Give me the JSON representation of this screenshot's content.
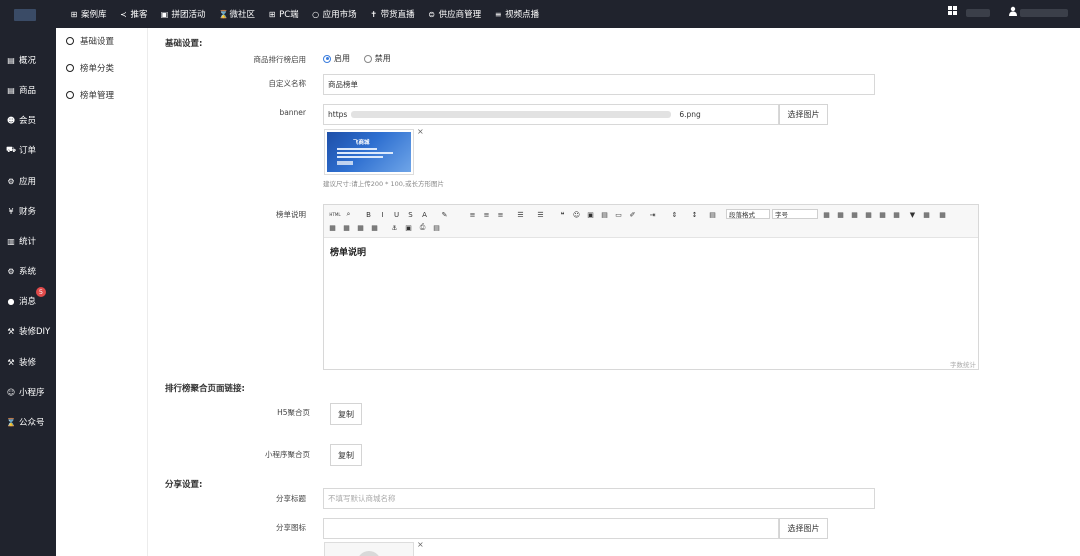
{
  "topnav": {
    "items": [
      {
        "icon": "plus-square-icon",
        "glyph": "⊞",
        "label": "案例库"
      },
      {
        "icon": "share-icon",
        "glyph": "≺",
        "label": "推客"
      },
      {
        "icon": "image-icon",
        "glyph": "▣",
        "label": "拼团活动"
      },
      {
        "icon": "hourglass-icon",
        "glyph": "⌛",
        "label": "微社区"
      },
      {
        "icon": "plus-square-icon",
        "glyph": "⊞",
        "label": "PC端"
      },
      {
        "icon": "circle-icon",
        "glyph": "○",
        "label": "应用市场"
      },
      {
        "icon": "pin-icon",
        "glyph": "✝",
        "label": "带货直播"
      },
      {
        "icon": "skype-icon",
        "glyph": "⊜",
        "label": "供应商管理"
      },
      {
        "icon": "list-icon",
        "glyph": "≡",
        "label": "视频点播"
      }
    ]
  },
  "sidebar": {
    "items": [
      {
        "icon": "overview-icon",
        "glyph": "▤",
        "label": "概况"
      },
      {
        "icon": "goods-icon",
        "glyph": "▤",
        "label": "商品"
      },
      {
        "icon": "members-icon",
        "glyph": "☻",
        "label": "会员"
      },
      {
        "icon": "cart-icon",
        "glyph": "⛟",
        "label": "订单"
      },
      {
        "icon": "apps-icon",
        "glyph": "⚙",
        "label": "应用"
      },
      {
        "icon": "yen-icon",
        "glyph": "¥",
        "label": "财务"
      },
      {
        "icon": "bar-chart-icon",
        "glyph": "▥",
        "label": "统计"
      },
      {
        "icon": "gears-icon",
        "glyph": "⚙",
        "label": "系统"
      },
      {
        "icon": "chat-icon",
        "glyph": "●",
        "label": "消息",
        "badge": "5"
      },
      {
        "icon": "hammer-icon",
        "glyph": "⚒",
        "label": "装修DIY"
      },
      {
        "icon": "hammer-icon",
        "glyph": "⚒",
        "label": "装修"
      },
      {
        "icon": "wechat-icon",
        "glyph": "☺",
        "label": "小程序"
      },
      {
        "icon": "hourglass-icon",
        "glyph": "⌛",
        "label": "公众号"
      }
    ]
  },
  "subnav": {
    "items": [
      {
        "label": "基础设置"
      },
      {
        "label": "榜单分类"
      },
      {
        "label": "榜单管理"
      }
    ]
  },
  "form": {
    "section_basic": "基础设置:",
    "enable_label": "商品排行榜启用",
    "enable_on": "启用",
    "enable_off": "禁用",
    "enable_selected": "启用",
    "custom_name_label": "自定义名称",
    "custom_name_value": "商品榜单",
    "banner_label": "banner",
    "banner_url_start": "https",
    "banner_url_end": "6.png",
    "select_image": "选择图片",
    "thumb_title": "飞商城",
    "close_x": "×",
    "size_hint": "建议尺寸:请上传200 * 100,或长方形图片",
    "desc_label": "榜单说明",
    "editor_content": "榜单说明",
    "editor_para_format": "段落格式",
    "editor_font_size": "字号",
    "editor_html": "HTML",
    "editor_wordcount": "字数统计",
    "section_links": "排行榜聚合页面链接:",
    "h5_label": "H5聚合页",
    "copy": "复制",
    "mini_label": "小程序聚合页",
    "section_share": "分享设置:",
    "share_title_label": "分享标题",
    "share_title_placeholder": "不填写默认商城名称",
    "share_icon_label": "分享图标"
  },
  "colors": {
    "sidebar_bg": "#20232d",
    "accent": "#3b7ddd",
    "badge": "#e04a4a"
  }
}
